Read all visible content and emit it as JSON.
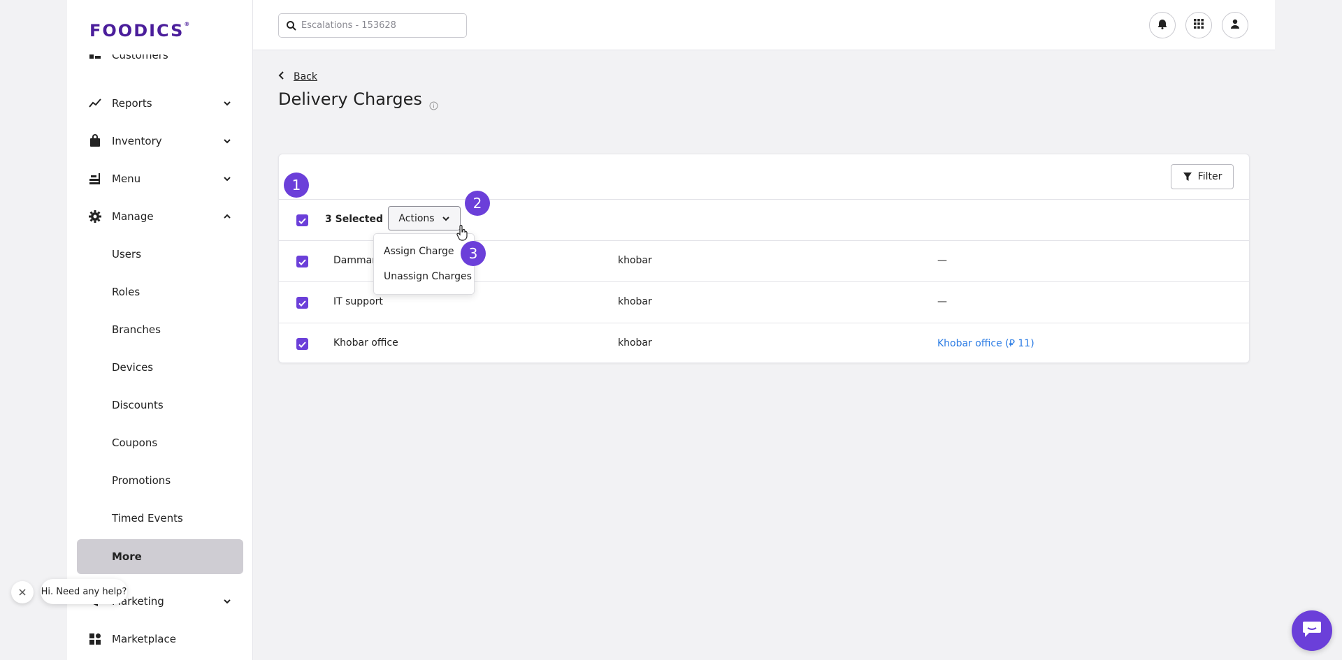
{
  "brand": {
    "logo": "FOODICS",
    "accent": "#6b3fd9"
  },
  "sidebar": {
    "cut_item": "Customers",
    "items": [
      {
        "label": "Reports",
        "icon": "chart-line-icon"
      },
      {
        "label": "Inventory",
        "icon": "shopping-bag-icon"
      },
      {
        "label": "Menu",
        "icon": "food-icon"
      },
      {
        "label": "Manage",
        "icon": "gear-icon"
      }
    ],
    "sub_items": [
      "Users",
      "Roles",
      "Branches",
      "Devices",
      "Discounts",
      "Coupons",
      "Promotions",
      "Timed Events",
      "More"
    ],
    "active_sub": "More",
    "bottom_items": [
      {
        "label": "Marketing"
      },
      {
        "label": "Marketplace"
      }
    ]
  },
  "topbar": {
    "search_placeholder": "Escalations - 153628"
  },
  "page": {
    "back_label": "Back",
    "title": "Delivery Charges"
  },
  "table": {
    "filter_label": "Filter",
    "selected_label": "3 Selected",
    "actions_label": "Actions",
    "rows": [
      {
        "name": "Dammam",
        "city": "khobar",
        "charge": "—"
      },
      {
        "name": "IT support",
        "city": "khobar",
        "charge": "—"
      },
      {
        "name": "Khobar office",
        "city": "khobar",
        "charge": "Khobar office (⃁ 11)"
      }
    ]
  },
  "dropdown": {
    "items": [
      "Assign Charge",
      "Unassign Charges"
    ]
  },
  "badges": [
    "1",
    "2",
    "3"
  ],
  "help": {
    "bubble": "Hi. Need any help?"
  }
}
